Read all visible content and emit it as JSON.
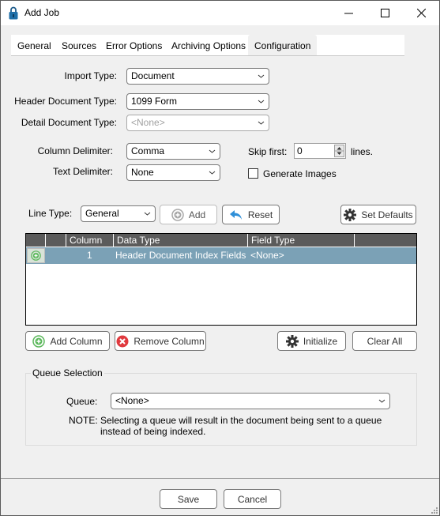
{
  "window": {
    "title": "Add Job",
    "icon": "padlock-icon",
    "controls": [
      "minimize-icon",
      "maximize-icon",
      "close-icon"
    ]
  },
  "tabs": [
    {
      "label": "General",
      "selected": false
    },
    {
      "label": "Sources",
      "selected": false
    },
    {
      "label": "Error Options",
      "selected": false
    },
    {
      "label": "Archiving Options",
      "selected": false
    },
    {
      "label": "Configuration",
      "selected": true
    }
  ],
  "form": {
    "import_type": {
      "label": "Import Type:",
      "value": "Document"
    },
    "header_doc_type": {
      "label": "Header Document Type:",
      "value": "1099 Form"
    },
    "detail_doc_type": {
      "label": "Detail Document Type:",
      "value": "<None>",
      "disabled": true
    },
    "column_delimiter": {
      "label": "Column Delimiter:",
      "value": "Comma"
    },
    "text_delimiter": {
      "label": "Text Delimiter:",
      "value": "None"
    },
    "skip_first": {
      "label": "Skip first:",
      "value": "0",
      "suffix": "lines."
    },
    "generate_images": {
      "label": "Generate Images",
      "checked": false
    }
  },
  "line_type": {
    "label": "Line Type:",
    "value": "General",
    "add_label": "Add",
    "reset_label": "Reset",
    "set_defaults_label": "Set Defaults"
  },
  "grid": {
    "columns": [
      "",
      "",
      "Column",
      "Data Type",
      "Field Type",
      ""
    ],
    "rows": [
      {
        "column": "1",
        "data_type": "Header Document Index Fields",
        "field_type": "<None>"
      }
    ]
  },
  "grid_actions": {
    "add_column": "Add Column",
    "remove_column": "Remove Column",
    "initialize": "Initialize",
    "clear_all": "Clear All"
  },
  "queue": {
    "group_title": "Queue Selection",
    "label": "Queue:",
    "value": "<None>",
    "note_label": "NOTE:",
    "note_line1": "Selecting a queue will result in the document being sent to a queue",
    "note_line2": "instead of being indexed."
  },
  "footer": {
    "save_label": "Save",
    "cancel_label": "Cancel"
  },
  "colors": {
    "grid_header": "#5b5b5b",
    "grid_selected_row": "#7ba1b6",
    "add_icon": "#5cb85c",
    "remove_icon": "#e0393e",
    "reset_icon": "#2f8fd8"
  }
}
